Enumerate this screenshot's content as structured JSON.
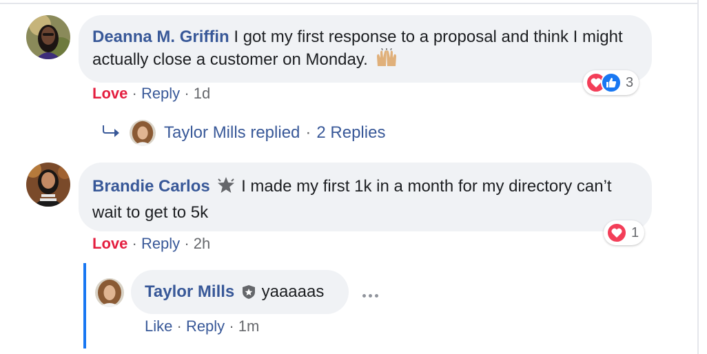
{
  "comments": [
    {
      "author": "Deanna M. Griffin",
      "text": "I got my first response to a proposal and think I might actually close a customer on Monday.",
      "emoji": "raising-hands-icon",
      "actions": {
        "love": "Love",
        "reply": "Reply",
        "time": "1d"
      },
      "reactions": {
        "types": [
          "love",
          "like"
        ],
        "count": "3"
      }
    },
    {
      "author": "Brandie Carlos",
      "text": "I made my first 1k in a month for my directory can’t wait to get to 5k",
      "actions": {
        "love": "Love",
        "reply": "Reply",
        "time": "2h"
      },
      "reactions": {
        "types": [
          "love"
        ],
        "count": "1"
      }
    }
  ],
  "replies_summary": {
    "replier": "Taylor Mills replied",
    "count_label": "2 Replies"
  },
  "reply": {
    "author": "Taylor Mills",
    "text": "yaaaaas",
    "actions": {
      "like": "Like",
      "reply": "Reply",
      "time": "1m"
    }
  },
  "colors": {
    "link": "#385898",
    "love": "#e41e3f",
    "bubble": "#f0f2f5",
    "thread_line": "#1877f2",
    "meta": "#65676b"
  },
  "separator": "·"
}
